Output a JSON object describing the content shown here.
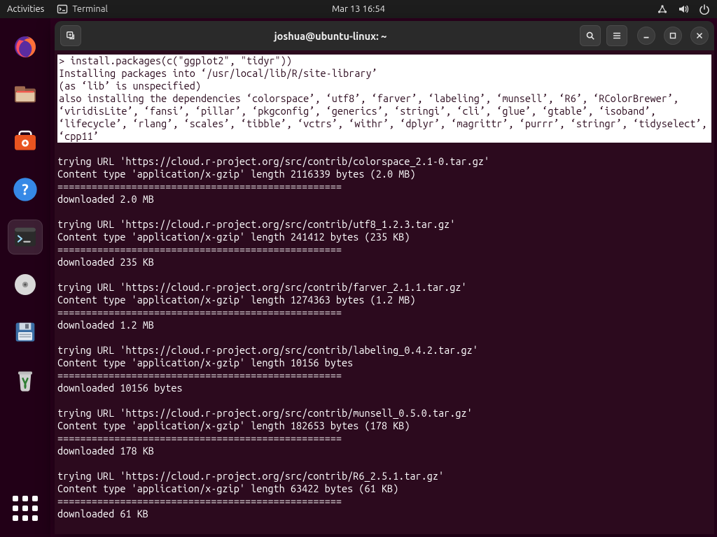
{
  "topbar": {
    "activities": "Activities",
    "app_name": "Terminal",
    "datetime": "Mar 13  16:54"
  },
  "dock": {
    "items": [
      {
        "name": "firefox"
      },
      {
        "name": "files"
      },
      {
        "name": "software"
      },
      {
        "name": "help"
      },
      {
        "name": "terminal",
        "selected": true
      },
      {
        "name": "disks"
      },
      {
        "name": "save"
      },
      {
        "name": "trash"
      }
    ]
  },
  "window": {
    "title": "joshua@ubuntu-linux: ~"
  },
  "terminal": {
    "highlight": "> install.packages(c(\"ggplot2\", \"tidyr\"))\nInstalling packages into ‘/usr/local/lib/R/site-library’\n(as ‘lib’ is unspecified)\nalso installing the dependencies ‘colorspace’, ‘utf8’, ‘farver’, ‘labeling’, ‘munsell’, ‘R6’, ‘RColorBrewer’, ‘viridisLite’, ‘fansi’, ‘pillar’, ‘pkgconfig’, ‘generics’, ‘stringi’, ‘cli’, ‘glue’, ‘gtable’, ‘isoband’, ‘lifecycle’, ‘rlang’, ‘scales’, ‘tibble’, ‘vctrs’, ‘withr’, ‘dplyr’, ‘magrittr’, ‘purrr’, ‘stringr’, ‘tidyselect’, ‘cpp11’\n",
    "body": "\ntrying URL 'https://cloud.r-project.org/src/contrib/colorspace_2.1-0.tar.gz'\nContent type 'application/x-gzip' length 2116339 bytes (2.0 MB)\n==================================================\ndownloaded 2.0 MB\n\ntrying URL 'https://cloud.r-project.org/src/contrib/utf8_1.2.3.tar.gz'\nContent type 'application/x-gzip' length 241412 bytes (235 KB)\n==================================================\ndownloaded 235 KB\n\ntrying URL 'https://cloud.r-project.org/src/contrib/farver_2.1.1.tar.gz'\nContent type 'application/x-gzip' length 1274363 bytes (1.2 MB)\n==================================================\ndownloaded 1.2 MB\n\ntrying URL 'https://cloud.r-project.org/src/contrib/labeling_0.4.2.tar.gz'\nContent type 'application/x-gzip' length 10156 bytes\n==================================================\ndownloaded 10156 bytes\n\ntrying URL 'https://cloud.r-project.org/src/contrib/munsell_0.5.0.tar.gz'\nContent type 'application/x-gzip' length 182653 bytes (178 KB)\n==================================================\ndownloaded 178 KB\n\ntrying URL 'https://cloud.r-project.org/src/contrib/R6_2.5.1.tar.gz'\nContent type 'application/x-gzip' length 63422 bytes (61 KB)\n==================================================\ndownloaded 61 KB\n"
  }
}
